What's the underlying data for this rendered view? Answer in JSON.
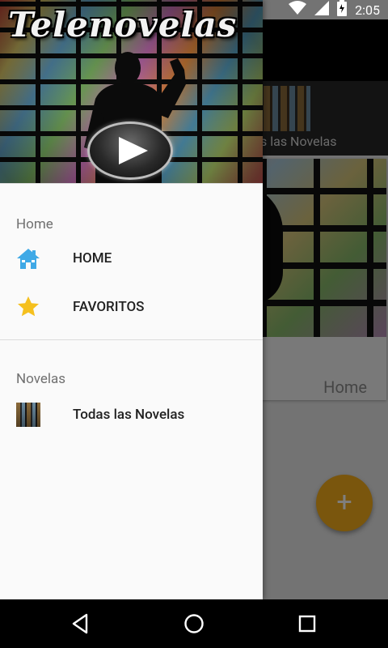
{
  "status_bar": {
    "time": "2:05",
    "icons": [
      "wifi-icon",
      "signal-icon",
      "battery-icon"
    ]
  },
  "app": {
    "tab_label": "s las Novelas",
    "card_label": "Home",
    "fab_symbol": "+",
    "fab_color": "#F4AC1B"
  },
  "drawer": {
    "header_title": "Telenovelas",
    "sections": [
      {
        "title": "Home",
        "items": [
          {
            "label": "HOME",
            "icon": "home-icon"
          },
          {
            "label": "FAVORITOS",
            "icon": "star-icon"
          }
        ]
      },
      {
        "title": "Novelas",
        "items": [
          {
            "label": "Todas las Novelas",
            "icon": "novela-thumbnail-icon"
          }
        ]
      }
    ]
  },
  "navigation_bar": {
    "buttons": [
      "back-icon",
      "home-circle-icon",
      "recents-icon"
    ]
  },
  "colors": {
    "home_icon": "#3FA9E6",
    "star_icon": "#F5C01E",
    "drawer_bg": "#FAFAFA"
  }
}
